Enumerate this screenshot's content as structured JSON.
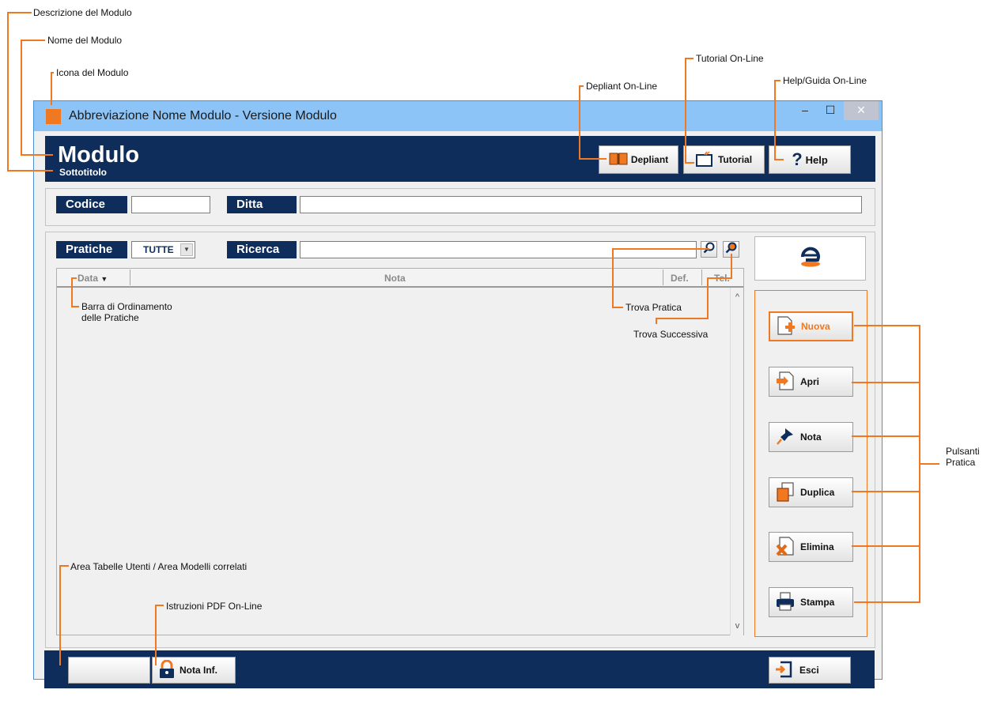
{
  "annotations": {
    "descrizione": "Descrizione del Modulo",
    "nome": "Nome del Modulo",
    "icona": "Icona del Modulo",
    "tutorial_online": "Tutorial On-Line",
    "depliant_online": "Depliant On-Line",
    "help_online": "Help/Guida On-Line",
    "barra_line1": "Barra di Ordinamento",
    "barra_line2": "delle Pratiche",
    "trova_pratica": "Trova Pratica",
    "trova_successiva": "Trova Successiva",
    "pulsanti_line1": "Pulsanti",
    "pulsanti_line2": "Pratica",
    "area_tabelle": "Area Tabelle Utenti / Area Modelli correlati",
    "istruzioni_pdf": "Istruzioni PDF On-Line"
  },
  "window": {
    "title": "Abbreviazione Nome Modulo - Versione Modulo",
    "minimize": "–",
    "maximize": "☐",
    "close": "✕"
  },
  "header": {
    "title": "Modulo",
    "subtitle": "Sottotitolo",
    "depliant_label": "Depliant",
    "tutorial_label": "Tutorial",
    "help_label": "Help"
  },
  "filters": {
    "codice_label": "Codice",
    "codice_value": "",
    "ditta_label": "Ditta",
    "ditta_value": "",
    "pratiche_label": "Pratiche",
    "pratiche_selected": "TUTTE",
    "ricerca_label": "Ricerca",
    "ricerca_value": ""
  },
  "grid": {
    "columns": {
      "data": "Data",
      "nota": "Nota",
      "def": "Def.",
      "tel": "Tel."
    },
    "rows": []
  },
  "actions": {
    "nuova": "Nuova",
    "apri": "Apri",
    "nota": "Nota",
    "duplica": "Duplica",
    "elimina": "Elimina",
    "stampa": "Stampa"
  },
  "footer": {
    "blank_label": "",
    "nota_inf_label": "Nota Inf.",
    "esci_label": "Esci"
  },
  "colors": {
    "accent": "#f07820",
    "navy": "#0f2d5a",
    "titlebar": "#8cc4f7"
  },
  "icons": {
    "module": "module-icon",
    "depliant": "book-icon",
    "tutorial": "tv-icon",
    "help": "question-icon",
    "search": "magnifier-icon",
    "search_next": "magnifier-next-icon",
    "logo": "app-logo-icon",
    "nuova": "new-doc-icon",
    "apri": "open-doc-icon",
    "nota": "pin-icon",
    "duplica": "duplicate-icon",
    "elimina": "delete-icon",
    "stampa": "printer-icon",
    "nota_inf": "lock-icon",
    "esci": "exit-icon"
  }
}
